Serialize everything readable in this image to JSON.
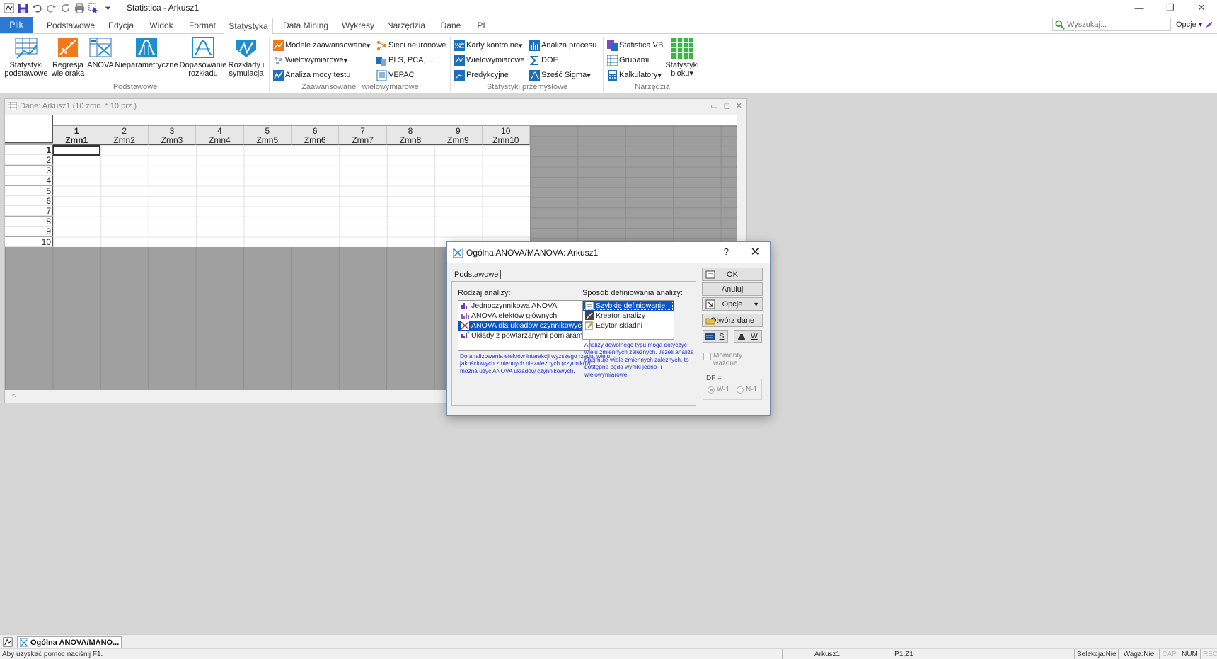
{
  "app": {
    "title": "Statistica - Arkusz1",
    "qat_icons": [
      "app-icon",
      "save-icon",
      "undo-icon",
      "redo-icon",
      "refresh-icon",
      "print-icon",
      "select-icon",
      "dropdown-icon"
    ]
  },
  "window_controls": {
    "minimize": "—",
    "restore": "❐",
    "close": "✕"
  },
  "tabs": [
    {
      "label": "Plik"
    },
    {
      "label": "Podstawowe"
    },
    {
      "label": "Edycja"
    },
    {
      "label": "Widok"
    },
    {
      "label": "Format"
    },
    {
      "label": "Statystyka"
    },
    {
      "label": "Data Mining"
    },
    {
      "label": "Wykresy"
    },
    {
      "label": "Narzędzia"
    },
    {
      "label": "Dane"
    },
    {
      "label": "PI"
    }
  ],
  "search": {
    "placeholder": "Wyszukaj..."
  },
  "options_label": "Opcje",
  "ribbon": {
    "groups": {
      "basic": "Podstawowe",
      "advanced": "Zaawansowane i wielowymiarowe",
      "industrial": "Statystyki przemysłowe",
      "tools": "Narzędzia"
    },
    "big_buttons": {
      "stat_basic_1": "Statystyki",
      "stat_basic_2": "podstawowe",
      "regression_1": "Regresja",
      "regression_2": "wieloraka",
      "anova": "ANOVA",
      "nonparam": "Nieparametryczne",
      "fit_1": "Dopasowanie",
      "fit_2": "rozkładu",
      "distrib_1": "Rozkłady i",
      "distrib_2": "symulacja",
      "block_1": "Statystyki",
      "block_2": "bloku"
    },
    "small_buttons": {
      "advanced_models": "Modele zaawansowane",
      "multivariate": "Wielowymiarowe",
      "power_analysis": "Analiza mocy testu",
      "neural_nets": "Sieci neuronowe",
      "pls_pca": "PLS, PCA, ...",
      "vepac": "VEPAC",
      "control_charts": "Karty kontrolne",
      "multivariate_ind": "Wielowymiarowe",
      "predictive": "Predykcyjne",
      "process_analysis": "Analiza procesu",
      "doe": "DOE",
      "six_sigma": "Sześć Sigma",
      "statistica_vb": "Statistica VB",
      "groups": "Grupami",
      "calculators": "Kalkulatory"
    }
  },
  "datawin": {
    "title": "Dane: Arkusz1 (10 zmn. * 10 prz.)",
    "columns": [
      {
        "num": "1",
        "name": "Zmn1"
      },
      {
        "num": "2",
        "name": "Zmn2"
      },
      {
        "num": "3",
        "name": "Zmn3"
      },
      {
        "num": "4",
        "name": "Zmn4"
      },
      {
        "num": "5",
        "name": "Zmn5"
      },
      {
        "num": "6",
        "name": "Zmn6"
      },
      {
        "num": "7",
        "name": "Zmn7"
      },
      {
        "num": "8",
        "name": "Zmn8"
      },
      {
        "num": "9",
        "name": "Zmn9"
      },
      {
        "num": "10",
        "name": "Zmn10"
      }
    ],
    "rows": [
      "1",
      "2",
      "3",
      "4",
      "5",
      "6",
      "7",
      "8",
      "9",
      "10"
    ],
    "scroll_left": "<"
  },
  "dialog": {
    "title": "Ogólna ANOVA/MANOVA: Arkusz1",
    "help": "?",
    "close": "✕",
    "tab": "Podstawowe",
    "analysis_type_label": "Rodzaj analizy:",
    "analysis_types": [
      "Jednoczynnikowa ANOVA",
      "ANOVA efektów głównych",
      "ANOVA dla układów czynnikowych",
      "Układy z powtarzanymi pomiarami"
    ],
    "selected_type_index": 2,
    "method_label": "Sposób definiowania analizy:",
    "methods": [
      "Szybkie definiowanie",
      "Kreator analizy",
      "Edytor składni"
    ],
    "selected_method_index": 0,
    "desc_left": "Do analizowania efektów interakcji wyższego rzędu, wielu jakościowych zmiennych niezależnych (czynników), można użyć ANOVA układów czynnikowych.",
    "desc_right": "Analizy dowolnego typu mogą dotyczyć wielu zmiennych zależnych. Jeżeli analiza obejmuje wiele zmiennych zależnych, to dostępne będą wyniki jedno- i wielowymiarowe.",
    "buttons": {
      "ok": "OK",
      "cancel": "Anuluj",
      "options": "Opcje",
      "open_data": "Otwórz dane",
      "s": "S",
      "w": "W"
    },
    "weighted_moments": "Momenty ważone",
    "df_label": "DF =",
    "df_options": [
      "W-1",
      "N-1"
    ]
  },
  "taskbar": {
    "item": "Ogólna ANOVA/MANO..."
  },
  "status": {
    "help": "Aby uzyskać pomoc naciśnij F1.",
    "sheet": "Arkusz1",
    "cell": "P1,Z1",
    "selection": "Selekcja:Nie",
    "weight": "Waga:Nie",
    "cap": "CAP",
    "num": "NUM",
    "rec": "REC"
  },
  "colors": {
    "accent": "#2b79d0",
    "selection": "#0a56c8",
    "desc_text": "#2233cc"
  }
}
